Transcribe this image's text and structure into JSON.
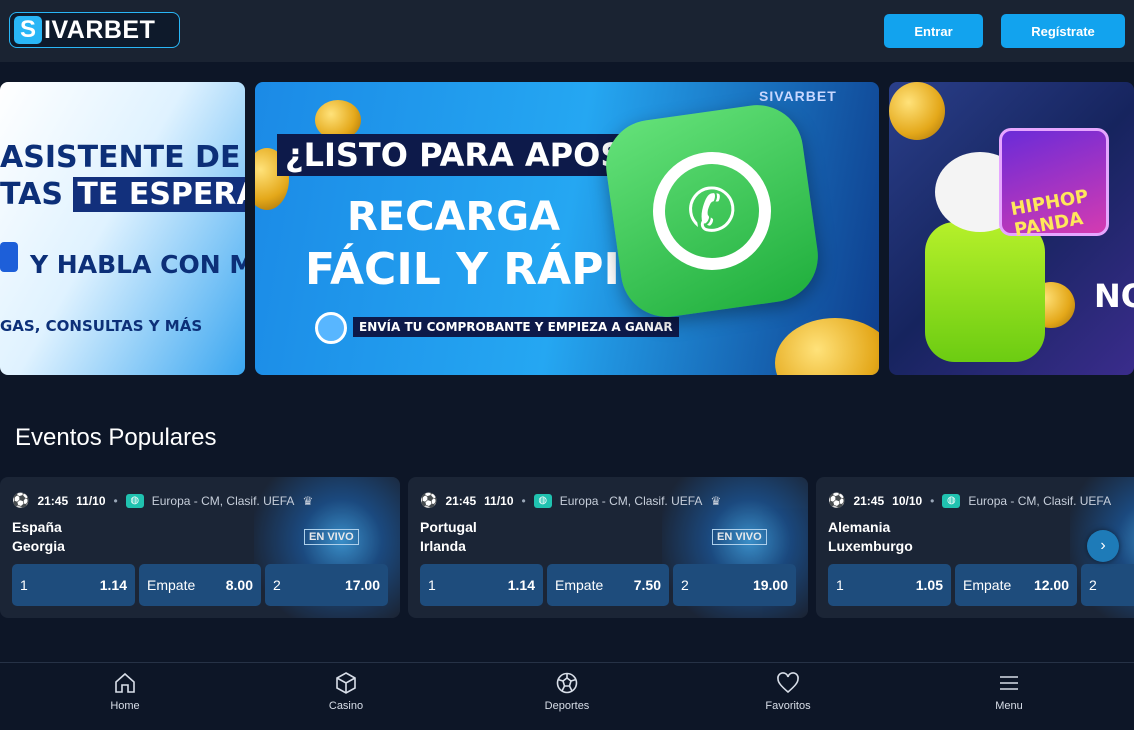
{
  "header": {
    "logo_s": "S",
    "logo_rest": "IVARBET",
    "login_label": "Entrar",
    "register_label": "Regístrate"
  },
  "banners": {
    "b1": {
      "line1": "ASISTENTE DE",
      "line2a": "TAS",
      "line2b": "TE ESPERA!",
      "line3": "Y HABLA CON MAYA.",
      "line4": "GAS, CONSULTAS Y MÁS"
    },
    "b2": {
      "brand": "SIVARBET",
      "question": "¿LISTO PARA APOSTAR?",
      "line1": "RECARGA",
      "line2": "FÁCIL Y RÁPIDO",
      "small": "ENVÍA TU COMPROBANTE Y EMPIEZA A GANAR"
    },
    "b3": {
      "game_title": "HIPHOP PANDA",
      "text": "NO K"
    }
  },
  "section_title": "Eventos Populares",
  "events": [
    {
      "time": "21:45",
      "date": "11/10",
      "league": "Europa - CM, Clasif. UEFA",
      "home": "España",
      "away": "Georgia",
      "live_label": "EN VIVO",
      "odd1_label": "1",
      "odd1": "1.14",
      "oddX_label": "Empate",
      "oddX": "8.00",
      "odd2_label": "2",
      "odd2": "17.00"
    },
    {
      "time": "21:45",
      "date": "11/10",
      "league": "Europa - CM, Clasif. UEFA",
      "home": "Portugal",
      "away": "Irlanda",
      "live_label": "EN VIVO",
      "odd1_label": "1",
      "odd1": "1.14",
      "oddX_label": "Empate",
      "oddX": "7.50",
      "odd2_label": "2",
      "odd2": "19.00"
    },
    {
      "time": "21:45",
      "date": "10/10",
      "league": "Europa - CM, Clasif. UEFA",
      "home": "Alemania",
      "away": "Luxemburgo",
      "odd1_label": "1",
      "odd1": "1.05",
      "oddX_label": "Empate",
      "oddX": "12.00",
      "odd2_label": "2"
    }
  ],
  "nav": {
    "home": "Home",
    "casino": "Casino",
    "sports": "Deportes",
    "favorites": "Favoritos",
    "menu": "Menu"
  },
  "colors": {
    "accent": "#12a3ee",
    "background": "#0d1627",
    "card": "#1b2536",
    "odd_button": "#1e4c7c"
  }
}
